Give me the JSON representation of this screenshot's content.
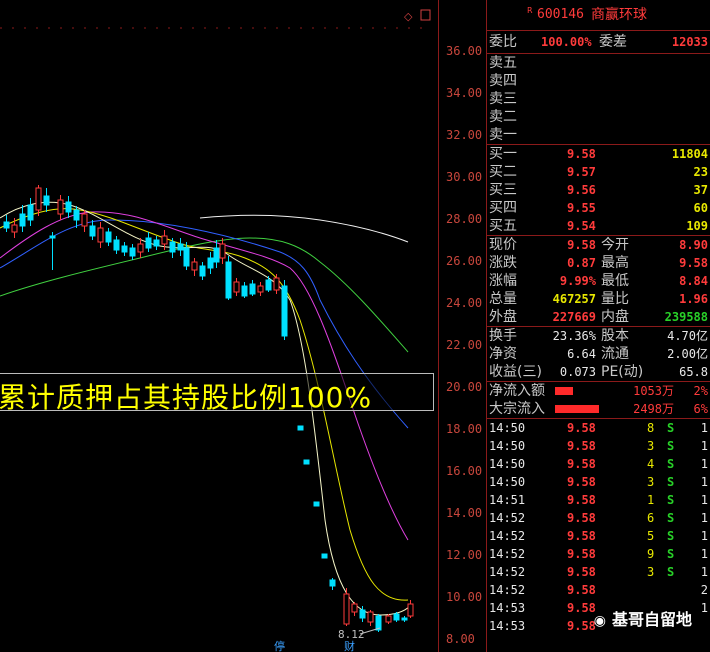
{
  "header": {
    "r_mark": "R",
    "code": "600146",
    "name": "商赢环球"
  },
  "axis": {
    "ticks": [
      "36.00",
      "34.00",
      "32.00",
      "30.00",
      "28.00",
      "26.00",
      "24.00",
      "22.00",
      "20.00",
      "18.00",
      "16.00",
      "14.00",
      "12.00",
      "10.00",
      "8.00"
    ]
  },
  "banner": {
    "text": "累计质押占其持股比例100%"
  },
  "chart_annotation": {
    "low_label": "8.12"
  },
  "bottom_labels": {
    "a": "停",
    "b": "财"
  },
  "committee": {
    "wb_label": "委比",
    "wb_value": "100.00%",
    "wc_label": "委差",
    "wc_value": "12033"
  },
  "sell": [
    {
      "label": "卖五",
      "price": "",
      "vol": ""
    },
    {
      "label": "卖四",
      "price": "",
      "vol": ""
    },
    {
      "label": "卖三",
      "price": "",
      "vol": ""
    },
    {
      "label": "卖二",
      "price": "",
      "vol": ""
    },
    {
      "label": "卖一",
      "price": "",
      "vol": ""
    }
  ],
  "buy": [
    {
      "label": "买一",
      "price": "9.58",
      "vol": "11804"
    },
    {
      "label": "买二",
      "price": "9.57",
      "vol": "23"
    },
    {
      "label": "买三",
      "price": "9.56",
      "vol": "37"
    },
    {
      "label": "买四",
      "price": "9.55",
      "vol": "60"
    },
    {
      "label": "买五",
      "price": "9.54",
      "vol": "109"
    }
  ],
  "quote": [
    {
      "l1": "现价",
      "v1": "9.58",
      "c1": "red",
      "l2": "今开",
      "v2": "8.90",
      "c2": "red"
    },
    {
      "l1": "涨跌",
      "v1": "0.87",
      "c1": "red",
      "l2": "最高",
      "v2": "9.58",
      "c2": "red"
    },
    {
      "l1": "涨幅",
      "v1": "9.99%",
      "c1": "red",
      "l2": "最低",
      "v2": "8.84",
      "c2": "red"
    },
    {
      "l1": "总量",
      "v1": "467257",
      "c1": "yellow",
      "l2": "量比",
      "v2": "1.96",
      "c2": "red"
    },
    {
      "l1": "外盘",
      "v1": "227669",
      "c1": "red",
      "l2": "内盘",
      "v2": "239588",
      "c2": "green"
    }
  ],
  "fundamentals": [
    {
      "l1": "换手",
      "v1": "23.36%",
      "l2": "股本",
      "v2": "4.70亿"
    },
    {
      "l1": "净资",
      "v1": "6.64",
      "l2": "流通",
      "v2": "2.00亿"
    },
    {
      "l1": "收益(三)",
      "v1": "0.073",
      "l2": "PE(动)",
      "v2": "65.8"
    }
  ],
  "flows": [
    {
      "label": "净流入额",
      "bar": 0.22,
      "value": "1053万",
      "pct": "2%"
    },
    {
      "label": "大宗流入",
      "bar": 0.55,
      "value": "2498万",
      "pct": "6%"
    }
  ],
  "ticks": [
    {
      "time": "14:50",
      "price": "9.58",
      "vol": "8",
      "side": "S",
      "n": "1"
    },
    {
      "time": "14:50",
      "price": "9.58",
      "vol": "3",
      "side": "S",
      "n": "1"
    },
    {
      "time": "14:50",
      "price": "9.58",
      "vol": "4",
      "side": "S",
      "n": "1"
    },
    {
      "time": "14:50",
      "price": "9.58",
      "vol": "3",
      "side": "S",
      "n": "1"
    },
    {
      "time": "14:51",
      "price": "9.58",
      "vol": "1",
      "side": "S",
      "n": "1"
    },
    {
      "time": "14:52",
      "price": "9.58",
      "vol": "6",
      "side": "S",
      "n": "1"
    },
    {
      "time": "14:52",
      "price": "9.58",
      "vol": "5",
      "side": "S",
      "n": "1"
    },
    {
      "time": "14:52",
      "price": "9.58",
      "vol": "9",
      "side": "S",
      "n": "1"
    },
    {
      "time": "14:52",
      "price": "9.58",
      "vol": "3",
      "side": "S",
      "n": "1"
    },
    {
      "time": "14:52",
      "price": "9.58",
      "vol": "",
      "side": "",
      "n": "2"
    },
    {
      "time": "14:53",
      "price": "9.58",
      "vol": "",
      "side": "",
      "n": "1"
    },
    {
      "time": "14:53",
      "price": "9.58",
      "vol": "",
      "side": "",
      "n": ""
    }
  ],
  "watermark": {
    "text": "基哥自留地"
  },
  "colors": {
    "up": "#ff3b3b",
    "down": "#00e0ff",
    "ma_white": "#f0f0f0",
    "ma_yellow": "#e8e800",
    "ma_magenta": "#e040e0",
    "ma_green": "#40d040",
    "ma_blue": "#3060ff",
    "grid": "#8b1a1a"
  }
}
